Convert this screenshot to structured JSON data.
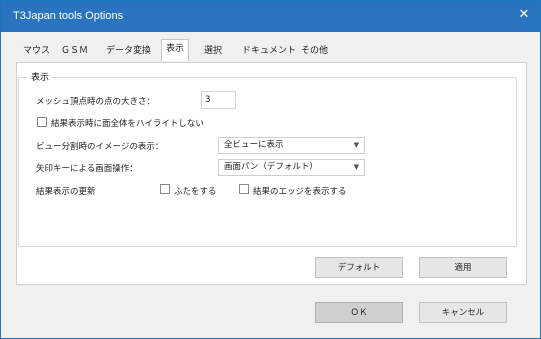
{
  "window": {
    "title": "T3Japan tools Options",
    "close_label": "✕"
  },
  "tabs": [
    {
      "label": "マウス"
    },
    {
      "label": "ＧＳＭ"
    },
    {
      "label": "データ変換"
    },
    {
      "label": "表示"
    },
    {
      "label": "選択"
    },
    {
      "label": "ドキュメント"
    },
    {
      "label": "その他"
    }
  ],
  "display": {
    "group_title": "表示",
    "mesh_point_size_label": "メッシュ頂点時の点の大きさ：",
    "mesh_point_size_value": "3",
    "no_highlight_label": "結果表示時に面全体をハイライトしない",
    "view_switch_label": "ビュー分割時のイメージの表示：",
    "view_switch_value": "全ビューに表示",
    "arrow_key_label": "矢印キーによる画面操作：",
    "arrow_key_value": "画面パン（デフォルト）",
    "result_display_label": "結果表示の更新",
    "close_label": "ふたをする",
    "edge_label": "結果のエッジを表示する"
  },
  "buttons": {
    "default": "デフォルト",
    "apply": "適用",
    "ok": "ＯＫ",
    "cancel": "キャンセル"
  }
}
